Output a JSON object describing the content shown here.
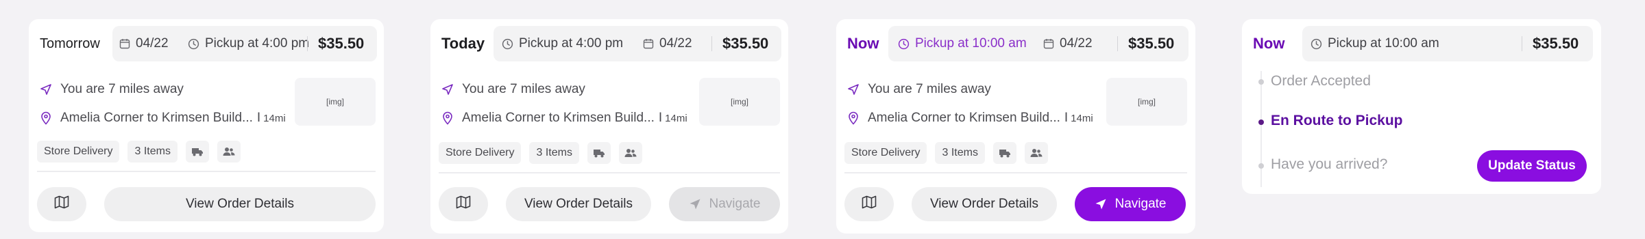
{
  "colors": {
    "accent": "#8a0ee0",
    "accent_text": "#6a0bb3",
    "background": "#f3f2f5",
    "card": "#ffffff"
  },
  "cards": [
    {
      "when": "Tomorrow",
      "date": "04/22",
      "pickup": "Pickup at 4:00 pm",
      "price": "$35.50",
      "distance_text": "You are 7 miles away",
      "route": "Amelia Corner to Krimsen Build...",
      "route_sep": "I",
      "route_distance": "14mi",
      "image_placeholder": "[img]",
      "tag_delivery": "Store Delivery",
      "tag_items": "3 Items",
      "details_button": "View Order Details"
    },
    {
      "when": "Today",
      "date": "04/22",
      "pickup": "Pickup at 4:00 pm",
      "price": "$35.50",
      "distance_text": "You are 7 miles away",
      "route": "Amelia Corner to Krimsen Build...",
      "route_sep": "I",
      "route_distance": "14mi",
      "image_placeholder": "[img]",
      "tag_delivery": "Store Delivery",
      "tag_items": "3 Items",
      "details_button": "View Order Details",
      "navigate_button": "Navigate",
      "navigate_state": "disabled"
    },
    {
      "when": "Now",
      "date": "04/22",
      "pickup": "Pickup at 10:00 am",
      "price": "$35.50",
      "distance_text": "You are 7 miles away",
      "route": "Amelia Corner to Krimsen Build...",
      "route_sep": "I",
      "route_distance": "14mi",
      "image_placeholder": "[img]",
      "tag_delivery": "Store Delivery",
      "tag_items": "3 Items",
      "details_button": "View Order Details",
      "navigate_button": "Navigate",
      "navigate_state": "active"
    },
    {
      "when": "Now",
      "pickup": "Pickup at 10:00 am",
      "price": "$35.50",
      "steps": [
        {
          "label": "Order Accepted",
          "state": "done"
        },
        {
          "label": "En Route to Pickup",
          "state": "active"
        },
        {
          "label": "Have you arrived?",
          "state": "pending"
        }
      ],
      "update_button": "Update Status"
    }
  ]
}
